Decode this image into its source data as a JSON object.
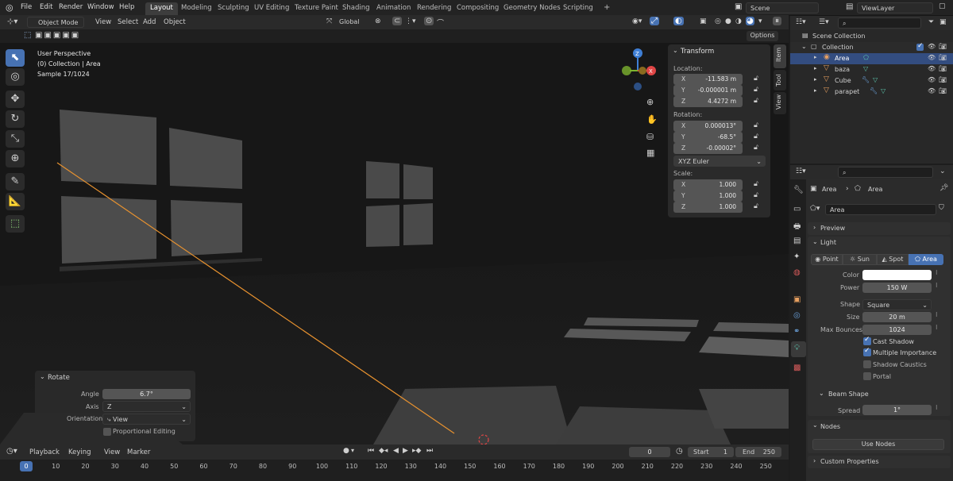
{
  "topbar": {
    "menus": [
      "File",
      "Edit",
      "Render",
      "Window",
      "Help"
    ],
    "workspaces": [
      "Layout",
      "Modeling",
      "Sculpting",
      "UV Editing",
      "Texture Paint",
      "Shading",
      "Animation",
      "Rendering",
      "Compositing",
      "Geometry Nodes",
      "Scripting"
    ],
    "scene": "Scene",
    "view_layer": "ViewLayer"
  },
  "viewport_header": {
    "mode": "Object Mode",
    "menus": [
      "View",
      "Select",
      "Add",
      "Object"
    ],
    "orientation": "Global",
    "options": "Options"
  },
  "overlay_text": {
    "line1": "User Perspective",
    "line2": "(0) Collection | Area",
    "line3": "Sample 17/1024"
  },
  "sidebar_tabs": [
    "Item",
    "Tool",
    "View"
  ],
  "transform": {
    "title": "Transform",
    "location_label": "Location:",
    "location": [
      {
        "axis": "X",
        "value": "-11.583 m"
      },
      {
        "axis": "Y",
        "value": "-0.000001 m"
      },
      {
        "axis": "Z",
        "value": "4.4272 m"
      }
    ],
    "rotation_label": "Rotation:",
    "rotation": [
      {
        "axis": "X",
        "value": "0.000013°"
      },
      {
        "axis": "Y",
        "value": "-68.5°"
      },
      {
        "axis": "Z",
        "value": "-0.00002°"
      }
    ],
    "rotation_mode": "XYZ Euler",
    "scale_label": "Scale:",
    "scale": [
      {
        "axis": "X",
        "value": "1.000"
      },
      {
        "axis": "Y",
        "value": "1.000"
      },
      {
        "axis": "Z",
        "value": "1.000"
      }
    ]
  },
  "rotate_panel": {
    "title": "Rotate",
    "angle_label": "Angle",
    "angle": "6.7°",
    "axis_label": "Axis",
    "axis": "Z",
    "orientation_label": "Orientation",
    "orientation": "View",
    "proportional": "Proportional Editing"
  },
  "outliner": {
    "scene_collection": "Scene Collection",
    "collection": "Collection",
    "items": [
      "Area",
      "baza",
      "Cube",
      "parapet"
    ]
  },
  "properties": {
    "breadcrumb_obj": "Area",
    "breadcrumb_data": "Area",
    "datablock": "Area",
    "preview": "Preview",
    "light": "Light",
    "types": [
      "Point",
      "Sun",
      "Spot",
      "Area"
    ],
    "color_label": "Color",
    "power_label": "Power",
    "power": "150 W",
    "shape_label": "Shape",
    "shape": "Square",
    "size_label": "Size",
    "size": "20 m",
    "bounces_label": "Max Bounces",
    "bounces": "1024",
    "cast_shadow": "Cast Shadow",
    "multiple_importance": "Multiple Importance",
    "shadow_caustics": "Shadow Caustics",
    "portal": "Portal",
    "beam_shape": "Beam Shape",
    "spread_label": "Spread",
    "spread": "1°",
    "nodes": "Nodes",
    "use_nodes": "Use Nodes",
    "custom_props": "Custom Properties"
  },
  "timeline": {
    "menus": [
      "Playback",
      "Keying",
      "View",
      "Marker"
    ],
    "current_frame": "0",
    "start_label": "Start",
    "start": "1",
    "end_label": "End",
    "end": "250",
    "ticks": [
      "0",
      "10",
      "20",
      "30",
      "40",
      "50",
      "60",
      "70",
      "80",
      "90",
      "100",
      "110",
      "120",
      "130",
      "140",
      "150",
      "160",
      "170",
      "180",
      "190",
      "200",
      "210",
      "220",
      "230",
      "240",
      "250"
    ]
  },
  "colors": {
    "accent": "#4772b3",
    "light_line": "#e8922f",
    "gizmo_x": "#e04646",
    "gizmo_y": "#7db32f",
    "gizmo_z": "#3f7fd6"
  }
}
